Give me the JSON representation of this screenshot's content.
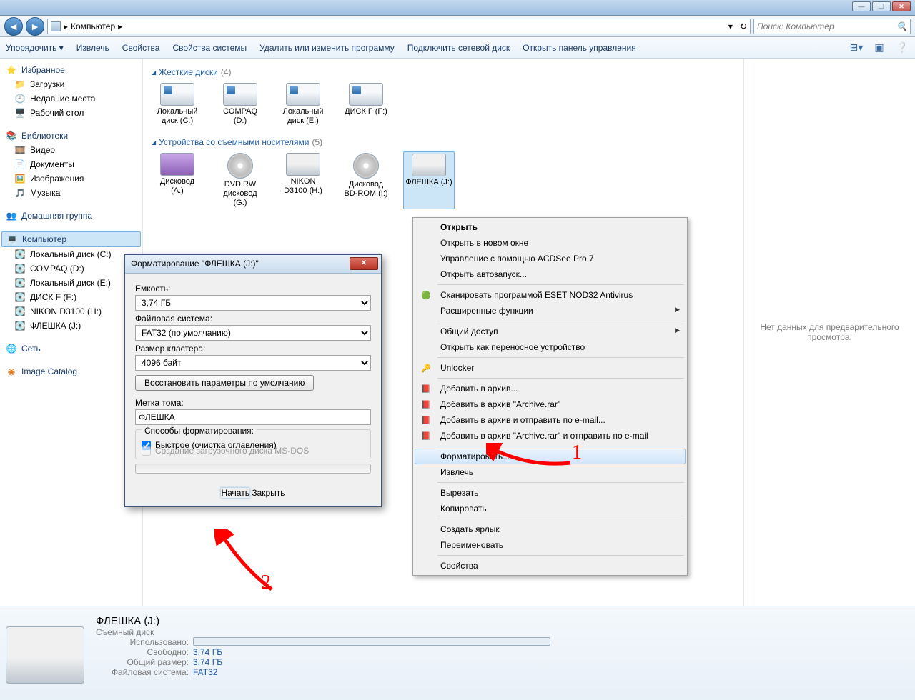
{
  "window": {
    "title": "Компьютер"
  },
  "nav": {
    "breadcrumb": [
      "Компьютер",
      "›"
    ],
    "search_placeholder": "Поиск: Компьютер"
  },
  "toolbar": {
    "items": [
      "Упорядочить ▾",
      "Извлечь",
      "Свойства",
      "Свойства системы",
      "Удалить или изменить программу",
      "Подключить сетевой диск",
      "Открыть панель управления"
    ]
  },
  "sidebar": {
    "favorites": {
      "header": "Избранное",
      "items": [
        "Загрузки",
        "Недавние места",
        "Рабочий стол"
      ]
    },
    "libraries": {
      "header": "Библиотеки",
      "items": [
        "Видео",
        "Документы",
        "Изображения",
        "Музыка"
      ]
    },
    "homegroup": {
      "header": "Домашняя группа"
    },
    "computer": {
      "header": "Компьютер",
      "items": [
        "Локальный диск (C:)",
        "COMPAQ (D:)",
        "Локальный диск (E:)",
        "ДИСК F (F:)",
        "NIKON D3100 (H:)",
        "ФЛЕШКА (J:)"
      ]
    },
    "network": {
      "header": "Сеть"
    },
    "catalog": {
      "header": "Image Catalog"
    }
  },
  "groups": {
    "hdd": {
      "title": "Жесткие диски",
      "count": "(4)",
      "drives": [
        {
          "label": "Локальный диск (C:)"
        },
        {
          "label": "COMPAQ (D:)"
        },
        {
          "label": "Локальный диск (E:)"
        },
        {
          "label": "ДИСК F (F:)"
        }
      ]
    },
    "rem": {
      "title": "Устройства со съемными носителями",
      "count": "(5)",
      "drives": [
        {
          "label": "Дисковод (A:)"
        },
        {
          "label": "DVD RW дисковод (G:)"
        },
        {
          "label": "NIKON D3100 (H:)"
        },
        {
          "label": "Дисковод BD-ROM (I:)"
        },
        {
          "label": "ФЛЕШКА (J:)"
        }
      ]
    }
  },
  "preview": {
    "text": "Нет данных для предварительного просмотра."
  },
  "details": {
    "title": "ФЛЕШКА (J:)",
    "subtitle": "Съемный диск",
    "rows": [
      {
        "k": "Использовано:",
        "v": ""
      },
      {
        "k": "Свободно:",
        "v": "3,74 ГБ"
      },
      {
        "k": "Общий размер:",
        "v": "3,74 ГБ"
      },
      {
        "k": "Файловая система:",
        "v": "FAT32"
      }
    ]
  },
  "ctx": {
    "items": [
      {
        "t": "Открыть",
        "bold": true
      },
      {
        "t": "Открыть в новом окне"
      },
      {
        "t": "Управление с помощью ACDSee Pro 7"
      },
      {
        "t": "Открыть автозапуск..."
      },
      {
        "sep": true
      },
      {
        "t": "Сканировать программой ESET NOD32 Antivirus",
        "ico": "🟢"
      },
      {
        "t": "Расширенные функции",
        "sub": true
      },
      {
        "sep": true
      },
      {
        "t": "Общий доступ",
        "sub": true
      },
      {
        "t": "Открыть как переносное устройство"
      },
      {
        "sep": true
      },
      {
        "t": "Unlocker",
        "ico": "🔑"
      },
      {
        "sep": true
      },
      {
        "t": "Добавить в архив...",
        "ico": "📕"
      },
      {
        "t": "Добавить в архив \"Archive.rar\"",
        "ico": "📕"
      },
      {
        "t": "Добавить в архив и отправить по e-mail...",
        "ico": "📕"
      },
      {
        "t": "Добавить в архив \"Archive.rar\" и отправить по e-mail",
        "ico": "📕"
      },
      {
        "sep": true
      },
      {
        "t": "Форматировать...",
        "hov": true
      },
      {
        "t": "Извлечь"
      },
      {
        "sep": true
      },
      {
        "t": "Вырезать"
      },
      {
        "t": "Копировать"
      },
      {
        "sep": true
      },
      {
        "t": "Создать ярлык"
      },
      {
        "t": "Переименовать"
      },
      {
        "sep": true
      },
      {
        "t": "Свойства"
      }
    ]
  },
  "dialog": {
    "title": "Форматирование \"ФЛЕШКА (J:)\"",
    "capacity_label": "Емкость:",
    "capacity": "3,74 ГБ",
    "fs_label": "Файловая система:",
    "fs": "FAT32 (по умолчанию)",
    "cluster_label": "Размер кластера:",
    "cluster": "4096 байт",
    "restore": "Восстановить параметры по умолчанию",
    "volume_label": "Метка тома:",
    "volume": "ФЛЕШКА",
    "methods_title": "Способы форматирования:",
    "quick": "Быстрое (очистка оглавления)",
    "msdos": "Создание загрузочного диска MS-DOS",
    "start": "Начать",
    "close": "Закрыть"
  },
  "annotations": {
    "n1": "1",
    "n2": "2"
  }
}
